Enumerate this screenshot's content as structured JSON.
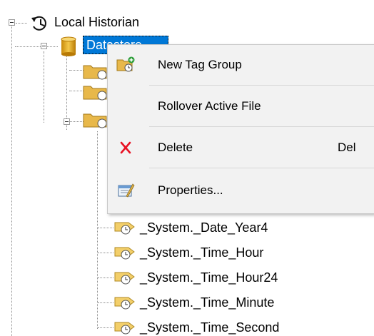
{
  "tree": {
    "root_label": "Local Historian",
    "datastore_label": "Datastore",
    "tags": [
      "_System._Date_Year4",
      "_System._Time_Hour",
      "_System._Time_Hour24",
      "_System._Time_Minute",
      "_System._Time_Second"
    ]
  },
  "context_menu": {
    "items": [
      {
        "label": "New Tag Group",
        "icon": "new-tag-group-icon",
        "shortcut": ""
      },
      {
        "label": "Rollover Active File",
        "icon": "",
        "shortcut": ""
      },
      {
        "label": "Delete",
        "icon": "delete-x-icon",
        "shortcut": "Del"
      },
      {
        "label": "Properties...",
        "icon": "properties-icon",
        "shortcut": ""
      }
    ]
  },
  "colors": {
    "selection": "#0078d7",
    "menu_background": "#f2f2f2",
    "delete_red": "#e81123"
  }
}
